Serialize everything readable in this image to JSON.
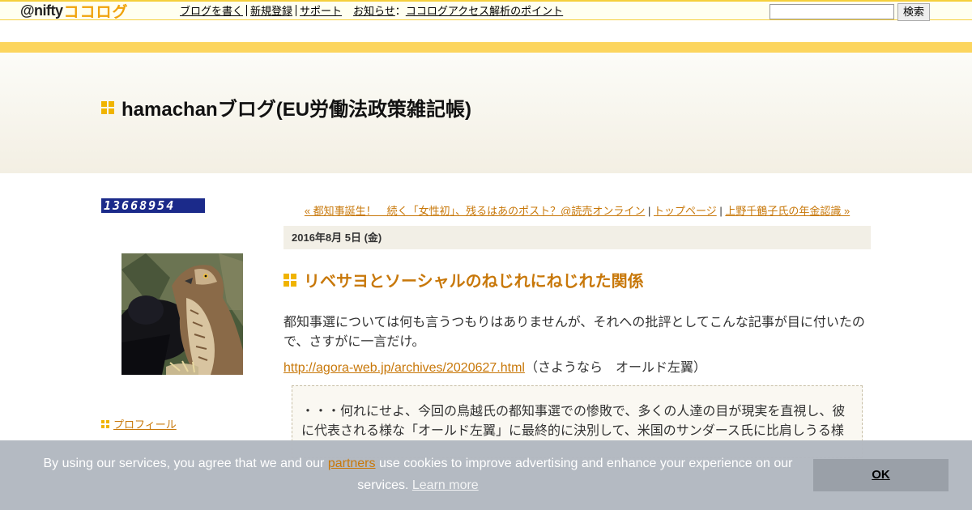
{
  "topbar": {
    "logo_at": "@nifty",
    "logo_coco": "ココログ",
    "links": {
      "write": "ブログを書く",
      "register": "新規登録",
      "support": "サポート",
      "news": "お知らせ",
      "news_colon": "：",
      "news_item": "ココログアクセス解析のポイント"
    },
    "search_placeholder": "",
    "search_button": "検索"
  },
  "header": {
    "site_title": "hamachanブログ(EU労働法政策雑記帳)"
  },
  "sidebar": {
    "counter": "13668954",
    "profile_label": "プロフィール"
  },
  "postnav": {
    "prev": "« 都知事誕生！　続く「女性初」、残るはあのポスト？@読売オンライン",
    "sep1": " | ",
    "top": "トップページ",
    "sep2": " | ",
    "next": "上野千鶴子氏の年金認識 »"
  },
  "entry": {
    "date": "2016年8月 5日 (金)",
    "title": "リベサヨとソーシャルのねじれにねじれた関係",
    "paragraph": "都知事選については何も言うつもりはありませんが、それへの批評としてこんな記事が目に付いたので、さすがに一言だけ。",
    "link_url": "http://agora-web.jp/archives/2020627.html",
    "link_note": "（さようなら　オールド左翼）",
    "quote": "・・・何れにせよ、今回の鳥越氏の都知事選での惨敗で、多くの人達の目が現実を直視し、彼に代表される様な「オールド左翼」に最終的に決別して、米国のサンダース氏に比肩しうる様"
  },
  "cookie": {
    "text_before": "By using our services, you agree that we and our ",
    "partners": "partners",
    "text_after": " use cookies to improve advertising and enhance your experience on our services. ",
    "learn_more": "Learn more",
    "ok": "OK"
  },
  "colors": {
    "accent": "#c8780a",
    "stripe": "#fcd55e",
    "square_icon": "#f0b400"
  }
}
